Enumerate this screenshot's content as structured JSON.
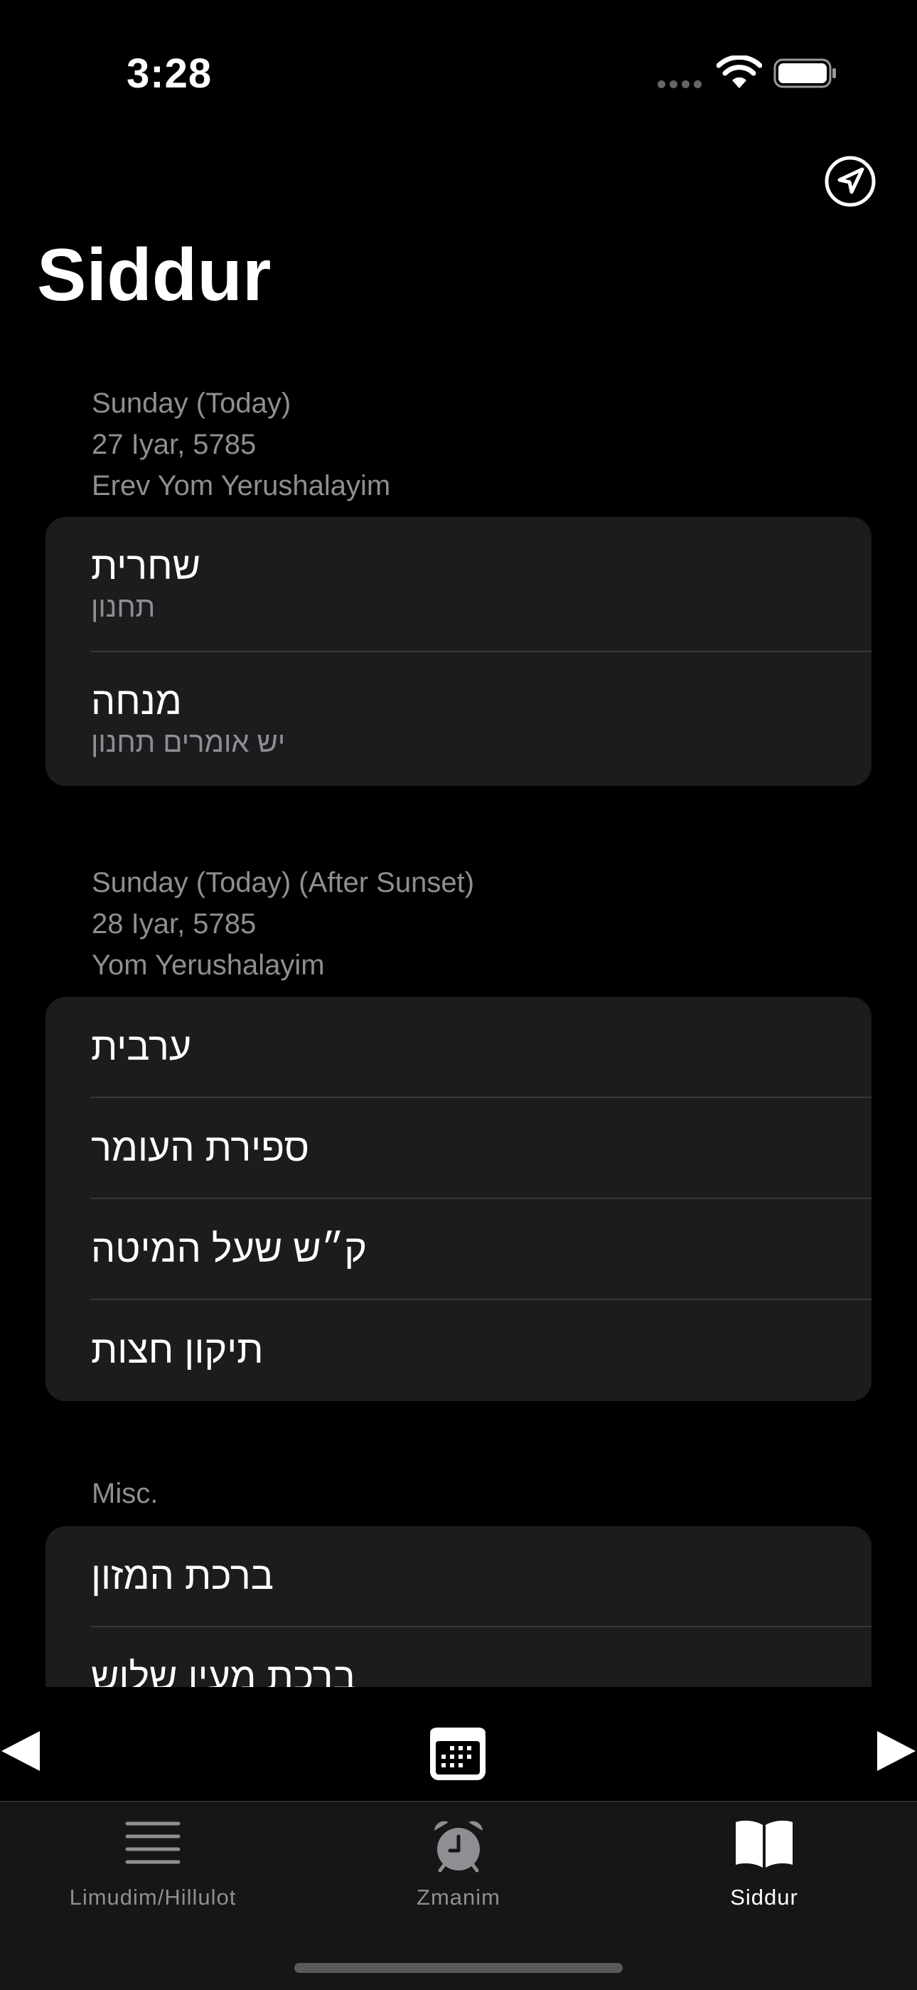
{
  "status_bar": {
    "time": "3:28"
  },
  "title": "Siddur",
  "sections": [
    {
      "header": [
        "Sunday (Today)",
        "27 Iyar, 5785",
        "Erev Yom Yerushalayim"
      ],
      "items": [
        {
          "title": "שחרית",
          "subtitle": "תחנון"
        },
        {
          "title": "מנחה",
          "subtitle": "יש אומרים תחנון"
        }
      ]
    },
    {
      "header": [
        "Sunday (Today) (After Sunset)",
        "28 Iyar, 5785",
        "Yom Yerushalayim"
      ],
      "items": [
        {
          "title": "ערבית"
        },
        {
          "title": "ספירת העומר"
        },
        {
          "title": "ק״ש שעל המיטה"
        },
        {
          "title": "תיקון חצות"
        }
      ]
    },
    {
      "header": [
        "Misc."
      ],
      "items": [
        {
          "title": "ברכת המזון"
        },
        {
          "title": "ברכת מעין שלוש"
        }
      ]
    }
  ],
  "tabs": [
    {
      "label": "Limudim/Hillulot",
      "icon": "list-icon",
      "active": false
    },
    {
      "label": "Zmanim",
      "icon": "alarm-clock-icon",
      "active": false
    },
    {
      "label": "Siddur",
      "icon": "book-icon",
      "active": true
    }
  ],
  "colors": {
    "background": "#000000",
    "card": "#1c1c1e",
    "secondary_text": "#8e8e93",
    "separator": "#38383a"
  }
}
